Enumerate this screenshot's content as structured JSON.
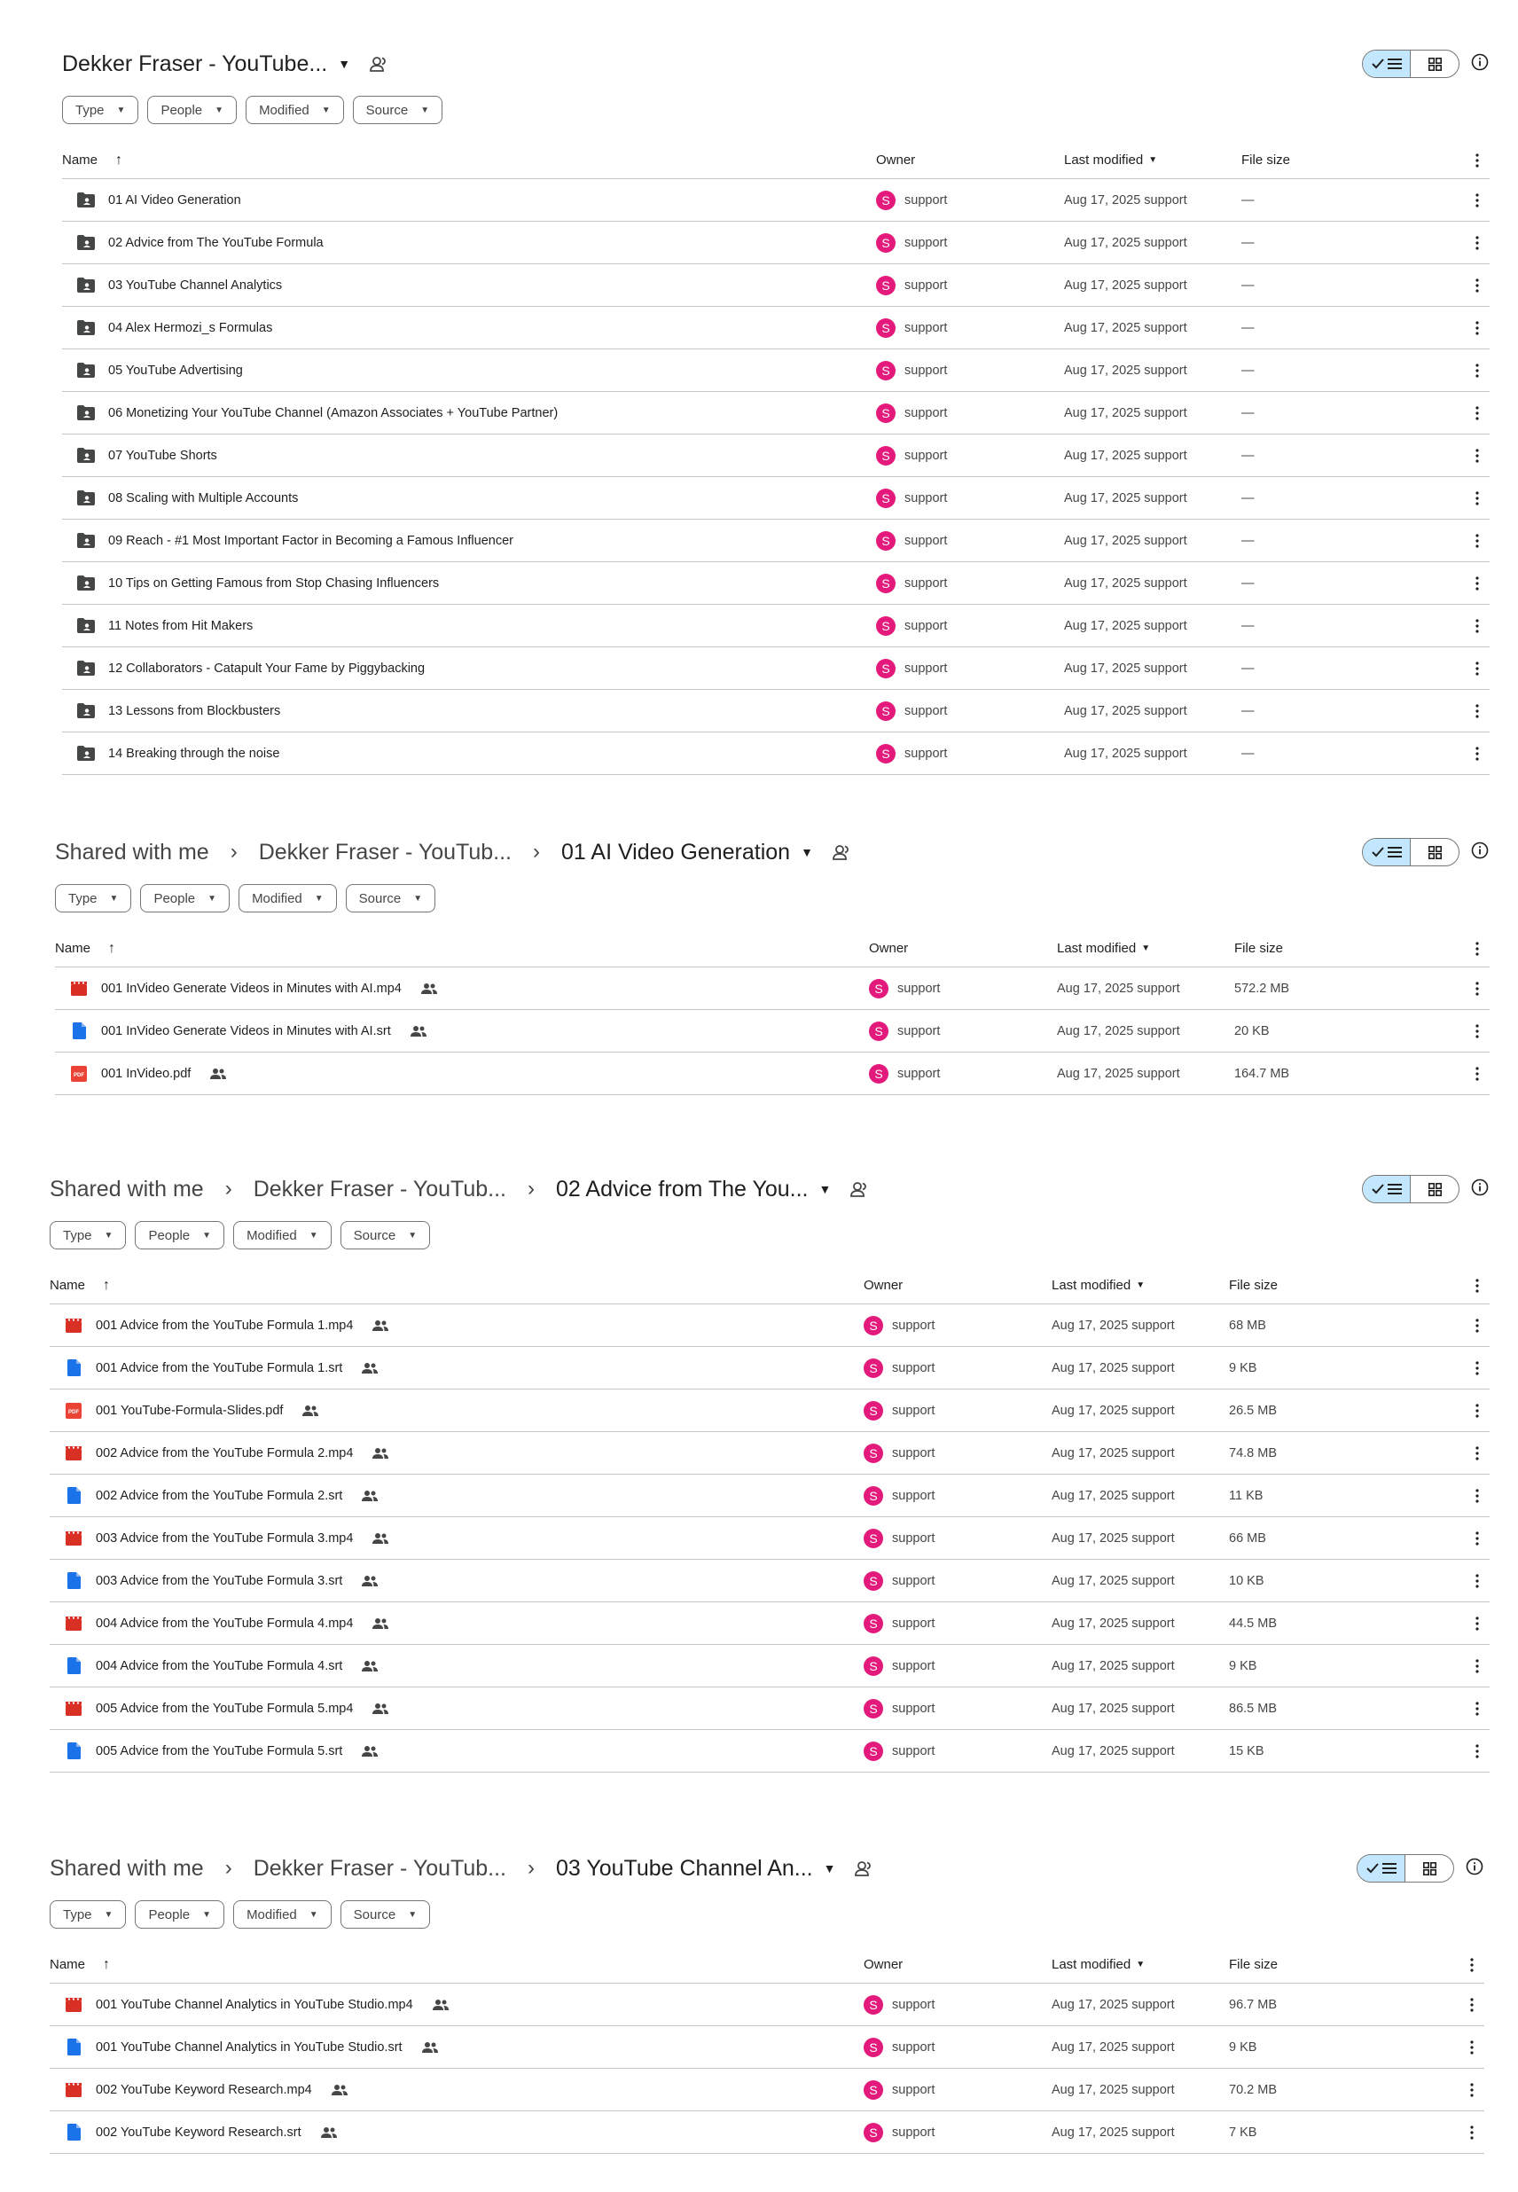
{
  "colors": {
    "avatar": "#e3197b",
    "toggle_active": "#c2e7ff",
    "video_icon": "#d93025",
    "doc_icon": "#1a73e8",
    "pdf_icon": "#ea4335",
    "folder_icon": "#444746"
  },
  "filters": [
    "Type",
    "People",
    "Modified",
    "Source"
  ],
  "headers": {
    "name": "Name",
    "owner": "Owner",
    "last_modified": "Last modified",
    "file_size": "File size"
  },
  "panels": [
    {
      "breadcrumbs": [],
      "title": "Dekker Fraser - YouTube...",
      "rows": [
        {
          "name": "01 AI Video Generation",
          "icon": "shared-folder-icon",
          "owner": "support",
          "modified": "Aug 17, 2025 support",
          "size": "—"
        },
        {
          "name": "02 Advice from The YouTube Formula",
          "icon": "shared-folder-icon",
          "owner": "support",
          "modified": "Aug 17, 2025 support",
          "size": "—"
        },
        {
          "name": "03 YouTube Channel Analytics",
          "icon": "shared-folder-icon",
          "owner": "support",
          "modified": "Aug 17, 2025 support",
          "size": "—"
        },
        {
          "name": "04 Alex Hermozi_s Formulas",
          "icon": "shared-folder-icon",
          "owner": "support",
          "modified": "Aug 17, 2025 support",
          "size": "—"
        },
        {
          "name": "05 YouTube Advertising",
          "icon": "shared-folder-icon",
          "owner": "support",
          "modified": "Aug 17, 2025 support",
          "size": "—"
        },
        {
          "name": "06 Monetizing Your YouTube Channel (Amazon Associates + YouTube Partner)",
          "icon": "shared-folder-icon",
          "owner": "support",
          "modified": "Aug 17, 2025 support",
          "size": "—"
        },
        {
          "name": "07 YouTube Shorts",
          "icon": "shared-folder-icon",
          "owner": "support",
          "modified": "Aug 17, 2025 support",
          "size": "—"
        },
        {
          "name": "08 Scaling with Multiple Accounts",
          "icon": "shared-folder-icon",
          "owner": "support",
          "modified": "Aug 17, 2025 support",
          "size": "—"
        },
        {
          "name": "09 Reach - #1 Most Important Factor in Becoming a Famous Influencer",
          "icon": "shared-folder-icon",
          "owner": "support",
          "modified": "Aug 17, 2025 support",
          "size": "—"
        },
        {
          "name": "10 Tips on Getting Famous from Stop Chasing Influencers",
          "icon": "shared-folder-icon",
          "owner": "support",
          "modified": "Aug 17, 2025 support",
          "size": "—"
        },
        {
          "name": "11 Notes from Hit Makers",
          "icon": "shared-folder-icon",
          "owner": "support",
          "modified": "Aug 17, 2025 support",
          "size": "—"
        },
        {
          "name": "12 Collaborators - Catapult Your Fame by Piggybacking",
          "icon": "shared-folder-icon",
          "owner": "support",
          "modified": "Aug 17, 2025 support",
          "size": "—"
        },
        {
          "name": "13 Lessons from Blockbusters",
          "icon": "shared-folder-icon",
          "owner": "support",
          "modified": "Aug 17, 2025 support",
          "size": "—"
        },
        {
          "name": "14 Breaking through the noise",
          "icon": "shared-folder-icon",
          "owner": "support",
          "modified": "Aug 17, 2025 support",
          "size": "—"
        }
      ]
    },
    {
      "breadcrumbs": [
        "Shared with me",
        "Dekker Fraser - YouTub..."
      ],
      "title": "01 AI Video Generation",
      "rows": [
        {
          "name": "001 InVideo Generate Videos in Minutes with AI.mp4",
          "icon": "video-icon",
          "owner": "support",
          "modified": "Aug 17, 2025 support",
          "size": "572.2 MB"
        },
        {
          "name": "001 InVideo Generate Videos in Minutes with AI.srt",
          "icon": "doc-icon",
          "owner": "support",
          "modified": "Aug 17, 2025 support",
          "size": "20 KB"
        },
        {
          "name": "001 InVideo.pdf",
          "icon": "pdf-icon",
          "owner": "support",
          "modified": "Aug 17, 2025 support",
          "size": "164.7 MB"
        }
      ]
    },
    {
      "breadcrumbs": [
        "Shared with me",
        "Dekker Fraser - YouTub..."
      ],
      "title": "02 Advice from The You...",
      "rows": [
        {
          "name": "001 Advice from the YouTube Formula 1.mp4",
          "icon": "video-icon",
          "owner": "support",
          "modified": "Aug 17, 2025 support",
          "size": "68 MB"
        },
        {
          "name": "001 Advice from the YouTube Formula 1.srt",
          "icon": "doc-icon",
          "owner": "support",
          "modified": "Aug 17, 2025 support",
          "size": "9 KB"
        },
        {
          "name": "001 YouTube-Formula-Slides.pdf",
          "icon": "pdf-icon",
          "owner": "support",
          "modified": "Aug 17, 2025 support",
          "size": "26.5 MB"
        },
        {
          "name": "002 Advice from the YouTube Formula 2.mp4",
          "icon": "video-icon",
          "owner": "support",
          "modified": "Aug 17, 2025 support",
          "size": "74.8 MB"
        },
        {
          "name": "002 Advice from the YouTube Formula 2.srt",
          "icon": "doc-icon",
          "owner": "support",
          "modified": "Aug 17, 2025 support",
          "size": "11 KB"
        },
        {
          "name": "003 Advice from the YouTube Formula 3.mp4",
          "icon": "video-icon",
          "owner": "support",
          "modified": "Aug 17, 2025 support",
          "size": "66 MB"
        },
        {
          "name": "003 Advice from the YouTube Formula 3.srt",
          "icon": "doc-icon",
          "owner": "support",
          "modified": "Aug 17, 2025 support",
          "size": "10 KB"
        },
        {
          "name": "004 Advice from the YouTube Formula 4.mp4",
          "icon": "video-icon",
          "owner": "support",
          "modified": "Aug 17, 2025 support",
          "size": "44.5 MB"
        },
        {
          "name": "004 Advice from the YouTube Formula 4.srt",
          "icon": "doc-icon",
          "owner": "support",
          "modified": "Aug 17, 2025 support",
          "size": "9 KB"
        },
        {
          "name": "005 Advice from the YouTube Formula 5.mp4",
          "icon": "video-icon",
          "owner": "support",
          "modified": "Aug 17, 2025 support",
          "size": "86.5 MB"
        },
        {
          "name": "005 Advice from the YouTube Formula 5.srt",
          "icon": "doc-icon",
          "owner": "support",
          "modified": "Aug 17, 2025 support",
          "size": "15 KB"
        }
      ]
    },
    {
      "breadcrumbs": [
        "Shared with me",
        "Dekker Fraser - YouTub..."
      ],
      "title": "03 YouTube Channel An...",
      "rows": [
        {
          "name": "001 YouTube Channel Analytics in YouTube Studio.mp4",
          "icon": "video-icon",
          "owner": "support",
          "modified": "Aug 17, 2025 support",
          "size": "96.7 MB"
        },
        {
          "name": "001 YouTube Channel Analytics in YouTube Studio.srt",
          "icon": "doc-icon",
          "owner": "support",
          "modified": "Aug 17, 2025 support",
          "size": "9 KB"
        },
        {
          "name": "002 YouTube Keyword Research.mp4",
          "icon": "video-icon",
          "owner": "support",
          "modified": "Aug 17, 2025 support",
          "size": "70.2 MB"
        },
        {
          "name": "002 YouTube Keyword Research.srt",
          "icon": "doc-icon",
          "owner": "support",
          "modified": "Aug 17, 2025 support",
          "size": "7 KB"
        }
      ]
    }
  ]
}
